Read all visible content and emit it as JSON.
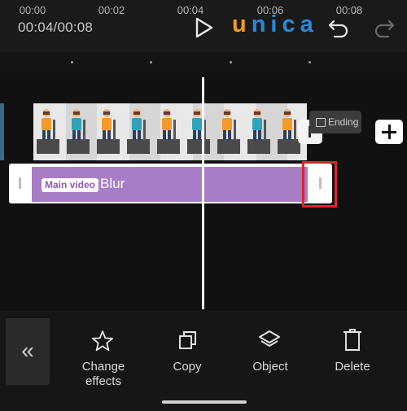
{
  "header": {
    "time": "00:04/00:08",
    "logo_letters": [
      "u",
      "nica"
    ]
  },
  "ruler": {
    "ticks": [
      "00:00",
      "00:02",
      "00:04",
      "00:06",
      "00:08"
    ]
  },
  "timeline": {
    "ending_label": "Ending",
    "effect": {
      "badge": "Main video",
      "name": "Blur"
    }
  },
  "toolbar": {
    "items": [
      {
        "label_line1": "Change",
        "label_line2": "effects",
        "icon": "star-icon"
      },
      {
        "label_line1": "Copy",
        "icon": "copy-icon"
      },
      {
        "label_line1": "Object",
        "icon": "layers-icon"
      },
      {
        "label_line1": "Delete",
        "icon": "trash-icon"
      }
    ],
    "collapse_icon": "«"
  },
  "colors": {
    "accent_purple": "#a77ec6",
    "highlight_red": "#e0232a",
    "logo_orange": "#f49a1b",
    "logo_blue": "#2a8ad6"
  }
}
